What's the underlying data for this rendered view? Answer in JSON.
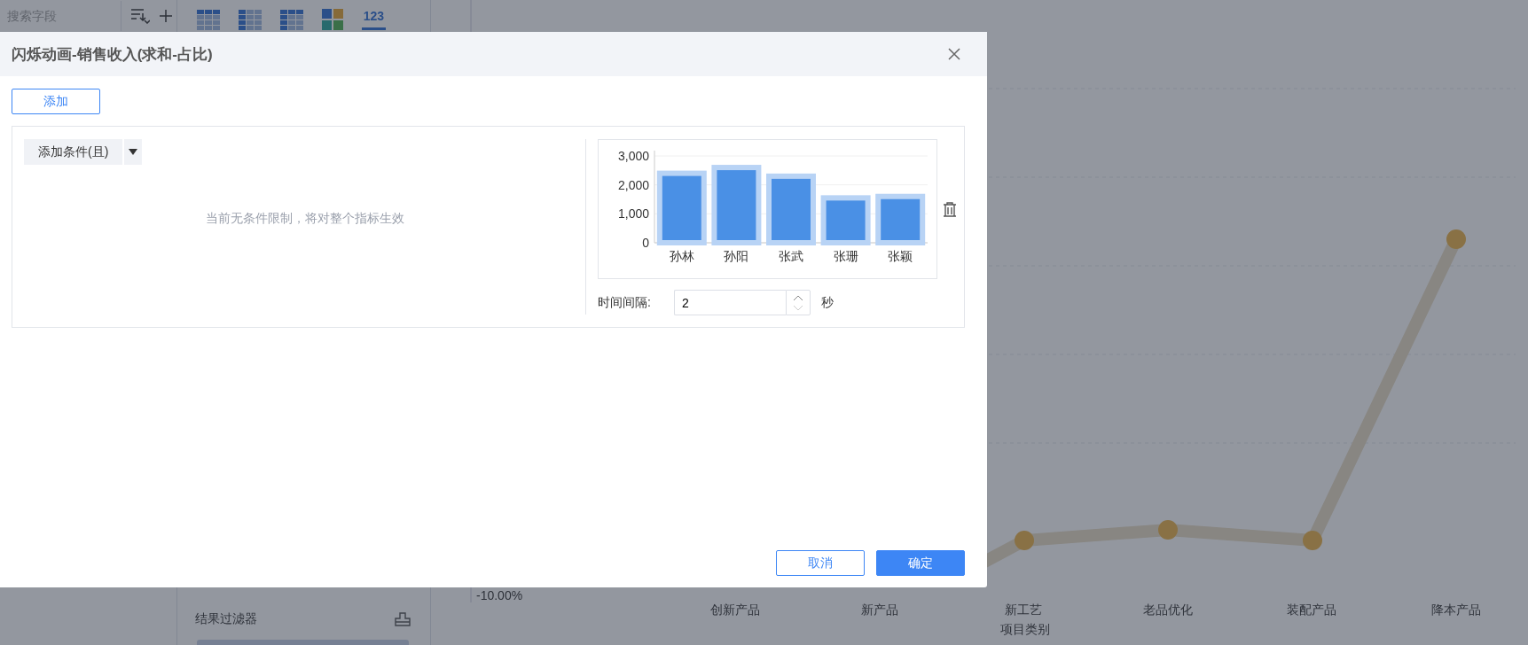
{
  "background": {
    "search_field": {
      "placeholder": "搜索字段"
    },
    "toolbar_number_icon": "123",
    "result_filter": {
      "title": "结果过滤器"
    },
    "line_chart": {
      "y_tick": "-10.00%",
      "x_title": "项目类别",
      "categories": [
        "创新产品",
        "新产品",
        "新工艺",
        "老品优化",
        "装配产品",
        "降本产品"
      ]
    }
  },
  "dialog": {
    "title": "闪烁动画-销售收入(求和-占比)",
    "add_button": "添加",
    "condition": {
      "add_condition_button": "添加条件(且)",
      "empty_message": "当前无条件限制，将对整个指标生效"
    },
    "preview": {
      "chart_data": {
        "type": "bar",
        "categories": [
          "孙林",
          "孙阳",
          "张武",
          "张珊",
          "张颖"
        ],
        "values": [
          2400,
          2600,
          2300,
          1550,
          1600
        ],
        "ylim": [
          0,
          3000
        ],
        "yticks": [
          {
            "value": 0,
            "label": "0"
          },
          {
            "value": 1000,
            "label": "1,000"
          },
          {
            "value": 2000,
            "label": "2,000"
          },
          {
            "value": 3000,
            "label": "3,000"
          }
        ]
      }
    },
    "interval": {
      "label": "时间间隔:",
      "value": "2",
      "unit": "秒"
    },
    "buttons": [
      {
        "label": "取消",
        "kind": "secondary"
      },
      {
        "label": "确定",
        "kind": "primary"
      }
    ]
  }
}
